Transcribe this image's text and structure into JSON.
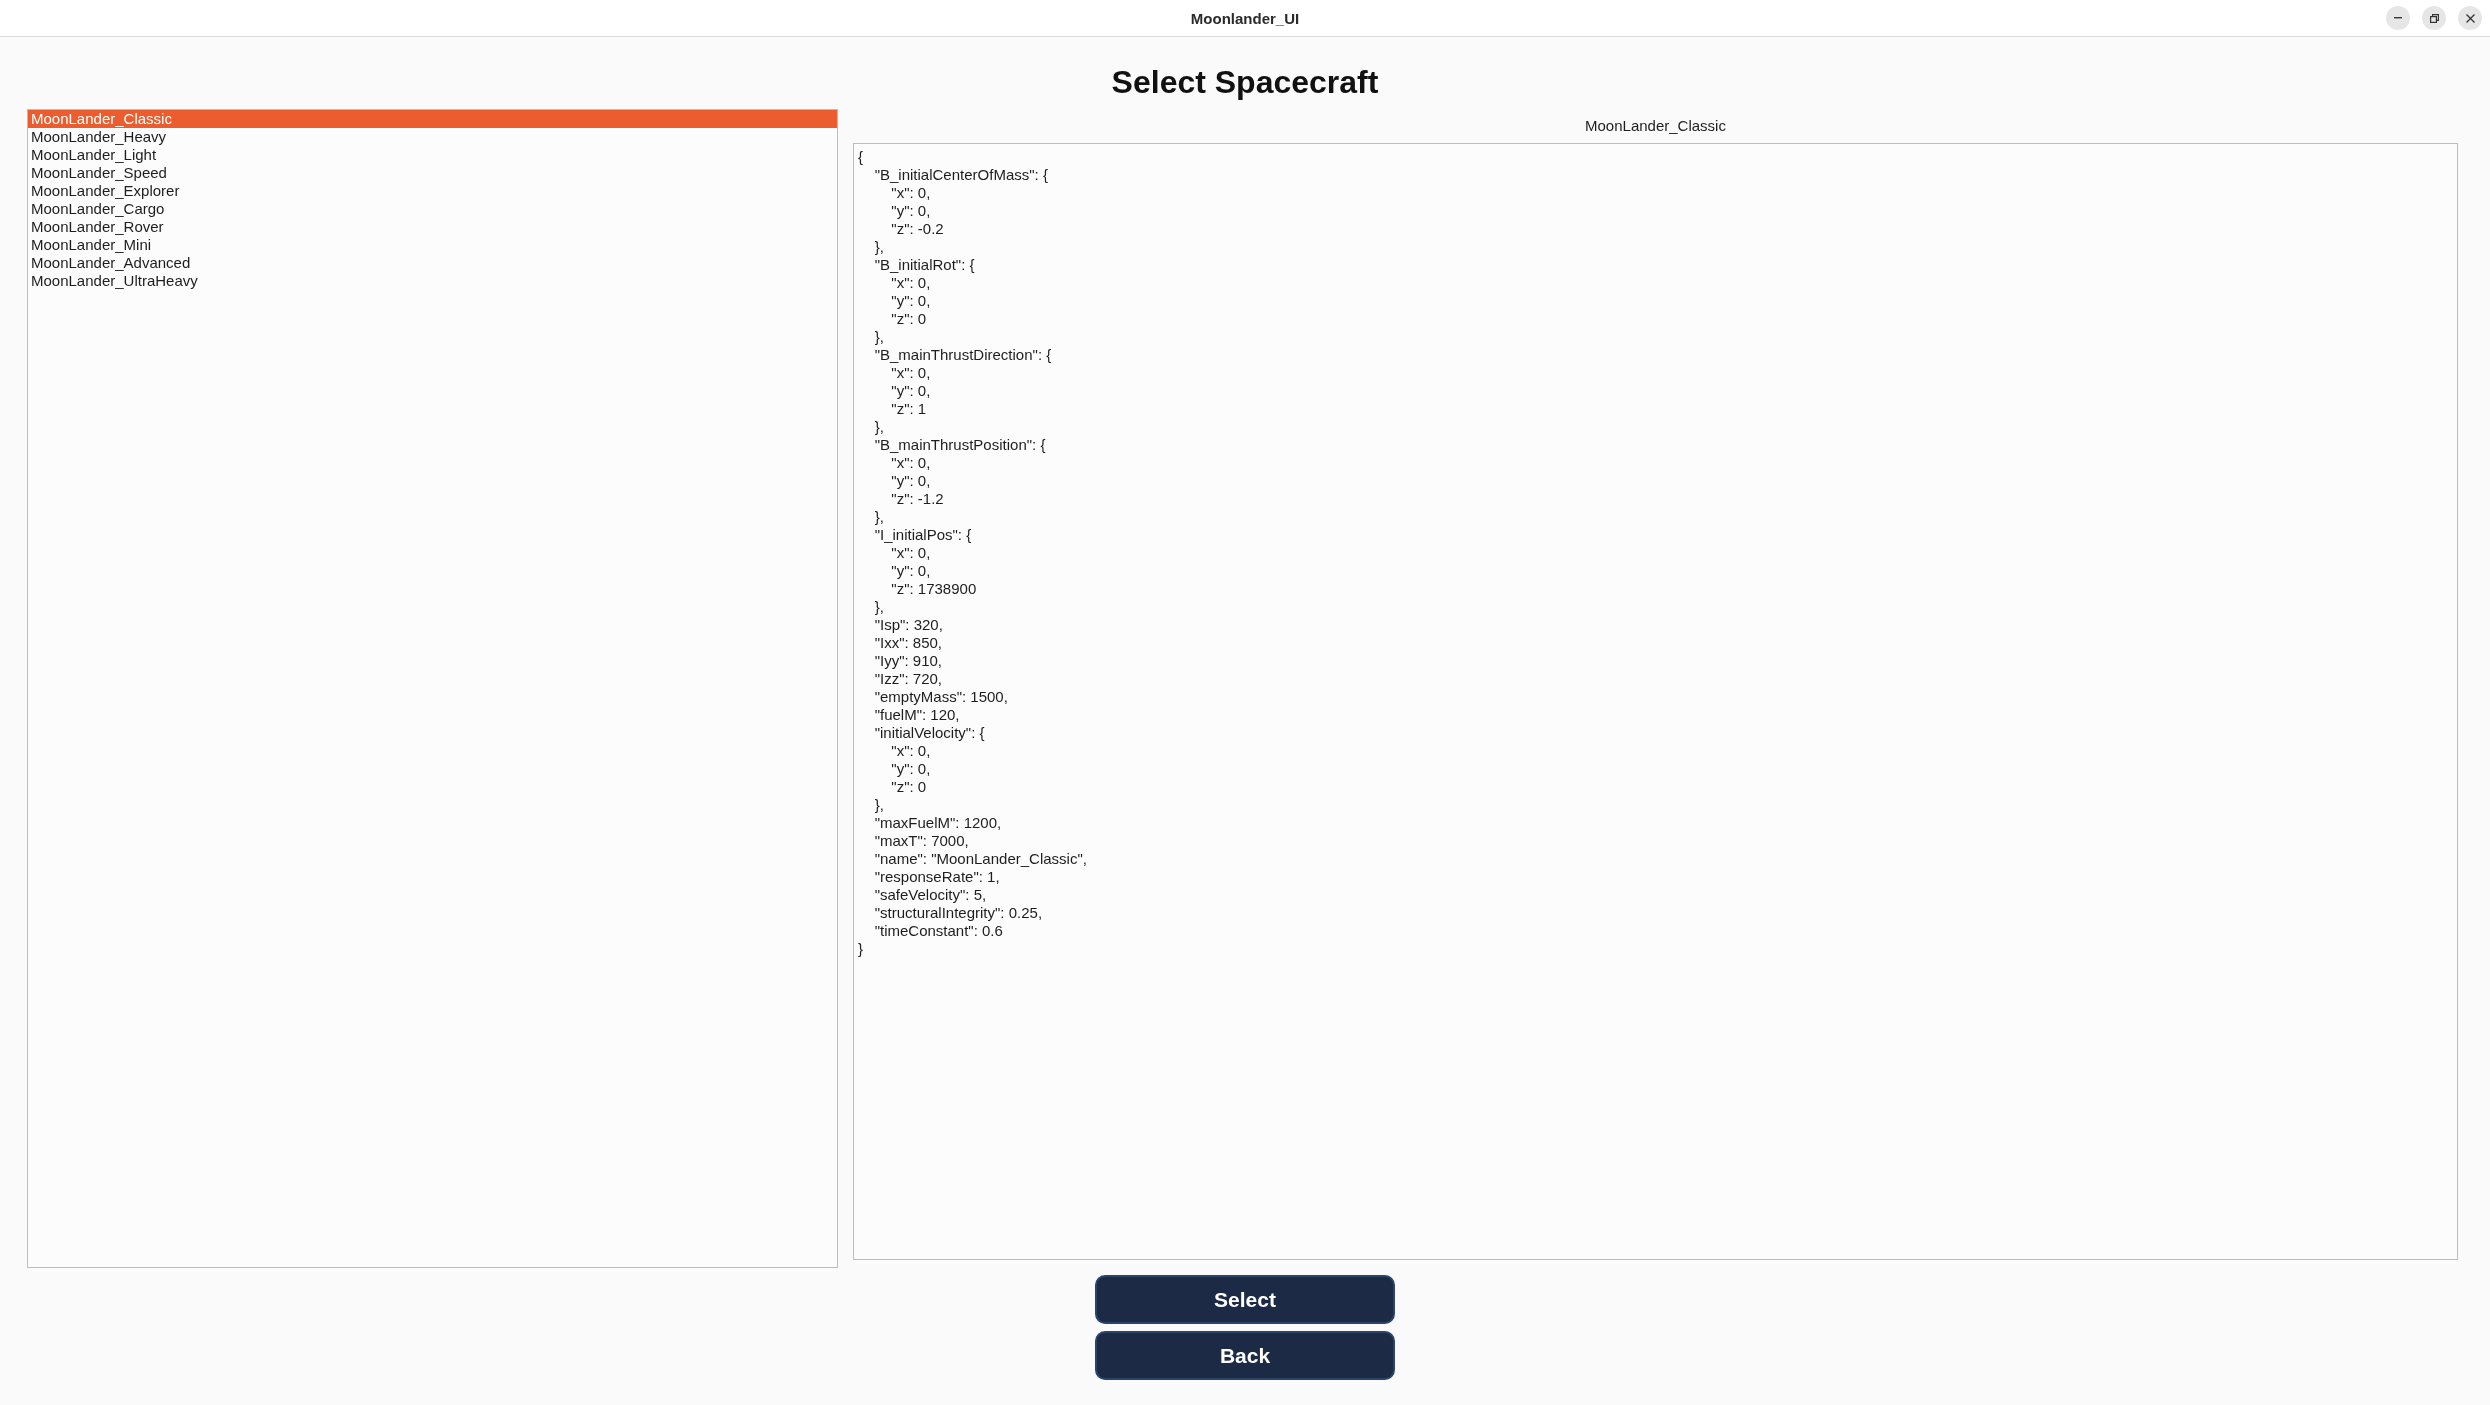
{
  "window": {
    "title": "Moonlander_UI"
  },
  "heading": "Select Spacecraft",
  "spacecraft_list": {
    "items": [
      {
        "label": "MoonLander_Classic",
        "selected": true
      },
      {
        "label": "MoonLander_Heavy",
        "selected": false
      },
      {
        "label": "MoonLander_Light",
        "selected": false
      },
      {
        "label": "MoonLander_Speed",
        "selected": false
      },
      {
        "label": "MoonLander_Explorer",
        "selected": false
      },
      {
        "label": "MoonLander_Cargo",
        "selected": false
      },
      {
        "label": "MoonLander_Rover",
        "selected": false
      },
      {
        "label": "MoonLander_Mini",
        "selected": false
      },
      {
        "label": "MoonLander_Advanced",
        "selected": false
      },
      {
        "label": "MoonLander_UltraHeavy",
        "selected": false
      }
    ]
  },
  "details": {
    "title": "MoonLander_Classic",
    "lines": [
      "{",
      "    \"B_initialCenterOfMass\": {",
      "        \"x\": 0,",
      "        \"y\": 0,",
      "        \"z\": -0.2",
      "    },",
      "    \"B_initialRot\": {",
      "        \"x\": 0,",
      "        \"y\": 0,",
      "        \"z\": 0",
      "    },",
      "    \"B_mainThrustDirection\": {",
      "        \"x\": 0,",
      "        \"y\": 0,",
      "        \"z\": 1",
      "    },",
      "    \"B_mainThrustPosition\": {",
      "        \"x\": 0,",
      "        \"y\": 0,",
      "        \"z\": -1.2",
      "    },",
      "    \"I_initialPos\": {",
      "        \"x\": 0,",
      "        \"y\": 0,",
      "        \"z\": 1738900",
      "    },",
      "    \"Isp\": 320,",
      "    \"Ixx\": 850,",
      "    \"Iyy\": 910,",
      "    \"Izz\": 720,",
      "    \"emptyMass\": 1500,",
      "    \"fuelM\": 120,",
      "    \"initialVelocity\": {",
      "        \"x\": 0,",
      "        \"y\": 0,",
      "        \"z\": 0",
      "    },",
      "    \"maxFuelM\": 1200,",
      "    \"maxT\": 7000,",
      "    \"name\": \"MoonLander_Classic\",",
      "    \"responseRate\": 1,",
      "    \"safeVelocity\": 5,",
      "    \"structuralIntegrity\": 0.25,",
      "    \"timeConstant\": 0.6",
      "}"
    ]
  },
  "buttons": [
    {
      "label": "Select"
    },
    {
      "label": "Back"
    }
  ]
}
